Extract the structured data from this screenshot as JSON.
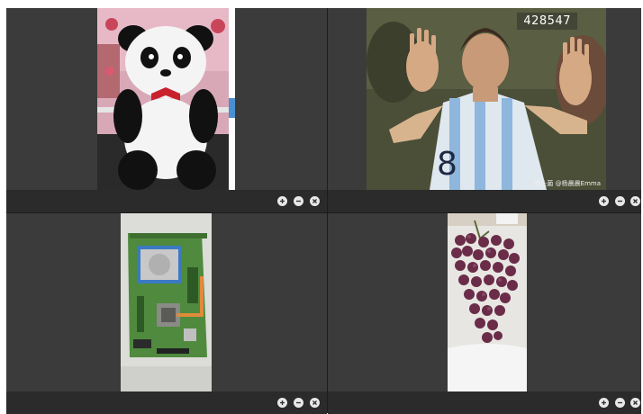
{
  "panels": [
    {
      "id": "panel-1",
      "image": "panda-plush-toy",
      "controls": [
        "zoom-in",
        "zoom-out",
        "close"
      ]
    },
    {
      "id": "panel-2",
      "image": "soccer-player-raising-hands",
      "counter": "428547",
      "watermark": "猎头菌 @杨晨晨Emma",
      "controls": [
        "zoom-in",
        "zoom-out",
        "close"
      ]
    },
    {
      "id": "panel-3",
      "image": "circuit-board-with-hard-drive",
      "controls": [
        "zoom-in",
        "zoom-out",
        "close"
      ]
    },
    {
      "id": "panel-4",
      "image": "bunch-of-red-grapes",
      "controls": [
        "zoom-in",
        "zoom-out",
        "close"
      ]
    }
  ],
  "colors": {
    "panel_bg": "#3b3b3b",
    "control_bar_bg": "#2b2b2b",
    "control_button": "#e8e8e8"
  }
}
